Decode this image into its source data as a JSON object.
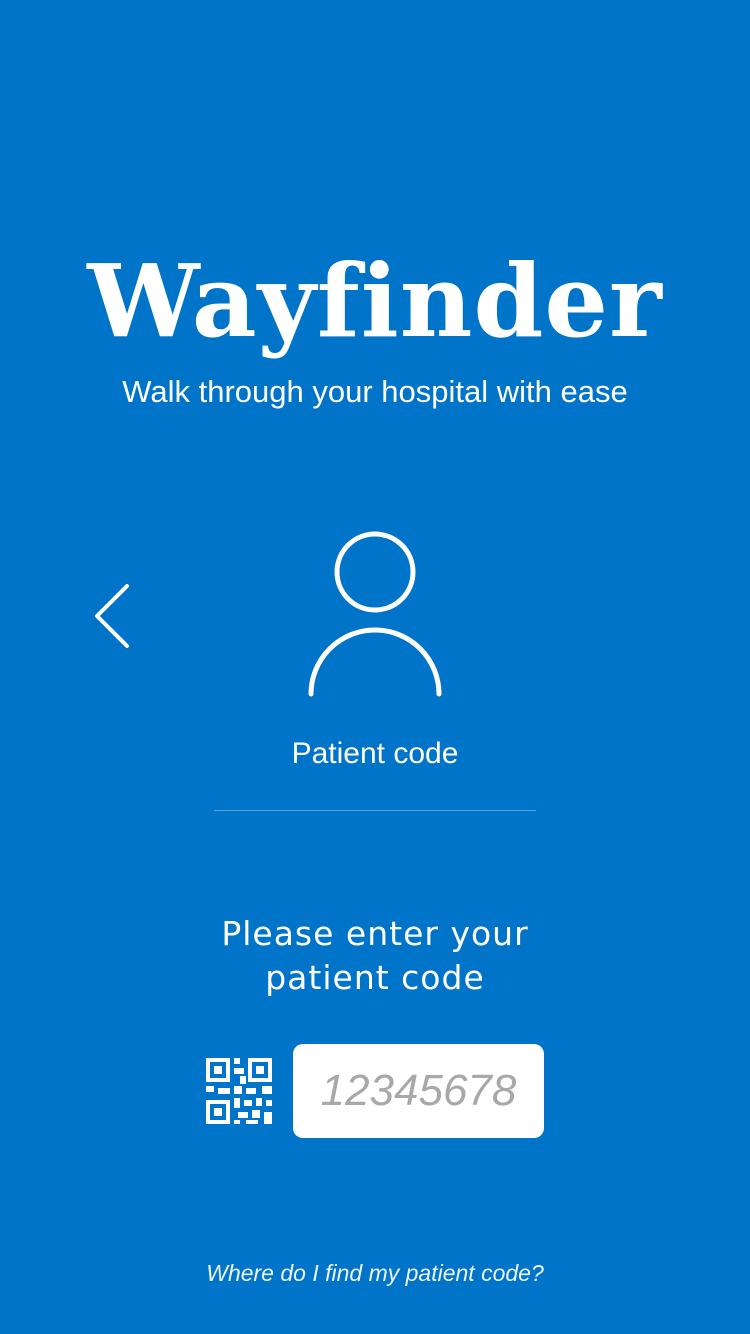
{
  "app": {
    "title": "Wayfinder",
    "tagline": "Walk through your hospital with ease"
  },
  "icons": {
    "back": "chevron-left-icon",
    "mode": "person-icon",
    "scan": "qr-code-icon"
  },
  "login_mode": {
    "label": "Patient code"
  },
  "prompt": {
    "line1": "Please enter your",
    "line2": "patient code"
  },
  "code_input": {
    "value": "",
    "placeholder": "12345678"
  },
  "help_link": {
    "label": "Where do I find my patient code?"
  },
  "colors": {
    "background": "#0074c8",
    "foreground": "#ffffff",
    "input_background": "#ffffff",
    "placeholder": "#a8a8a8"
  }
}
